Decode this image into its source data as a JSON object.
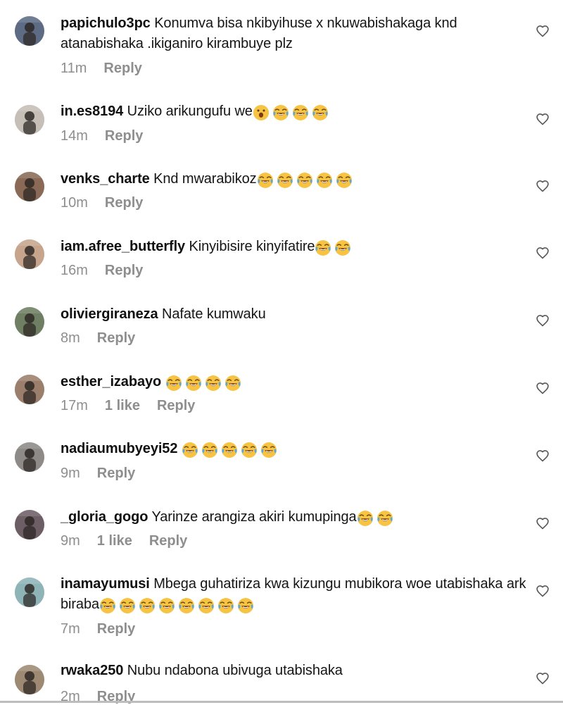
{
  "icons": {
    "like": "heart-outline-icon",
    "emoji_laugh": "face-with-tears-of-joy",
    "emoji_wow": "face-with-open-mouth"
  },
  "colors": {
    "text": "#151515",
    "meta": "#8e8e8e",
    "emoji_yellow": "#f6c343",
    "emoji_tears": "#53a8e8"
  },
  "comments": [
    {
      "username": "papichulo3pc",
      "text": "Konumva bisa nkibyihuse x nkuwabishakaga knd atanabishaka .ikiganiro kirambuye plz",
      "time": "11m",
      "likes": "",
      "reply": "Reply",
      "emojis": ""
    },
    {
      "username": "in.es8194",
      "text": "Uziko arikungufu we",
      "time": "14m",
      "likes": "",
      "reply": "Reply",
      "emojis": "😮😂😂😂"
    },
    {
      "username": "venks_charte",
      "text": "Knd mwarabikoz",
      "time": "10m",
      "likes": "",
      "reply": "Reply",
      "emojis": "😂😂😂😂😂"
    },
    {
      "username": "iam.afree_butterfly",
      "text": "Kinyibisire kinyifatire",
      "time": "16m",
      "likes": "",
      "reply": "Reply",
      "emojis": "😂😂"
    },
    {
      "username": "oliviergiraneza",
      "text": "Nafate kumwaku",
      "time": "8m",
      "likes": "",
      "reply": "Reply",
      "emojis": ""
    },
    {
      "username": "esther_izabayo",
      "text": "",
      "time": "17m",
      "likes": "1 like",
      "reply": "Reply",
      "emojis": "😂😂😂😂"
    },
    {
      "username": "nadiaumubyeyi52",
      "text": "",
      "time": "9m",
      "likes": "",
      "reply": "Reply",
      "emojis": "😂😂😂😂😂"
    },
    {
      "username": "_gloria_gogo",
      "text": "Yarinze arangiza akiri kumupinga",
      "time": "9m",
      "likes": "1 like",
      "reply": "Reply",
      "emojis": "😂😂"
    },
    {
      "username": "inamayumusi",
      "text": "Mbega guhatiriza kwa kizungu mubikora woe utabishaka ark biraba",
      "time": "7m",
      "likes": "",
      "reply": "Reply",
      "emojis": "😂😂😂😂😂😂😂😂"
    },
    {
      "username": "rwaka250",
      "text": "Nubu ndabona ubivuga utabishaka",
      "time": "2m",
      "likes": "",
      "reply": "Reply",
      "emojis": ""
    }
  ]
}
